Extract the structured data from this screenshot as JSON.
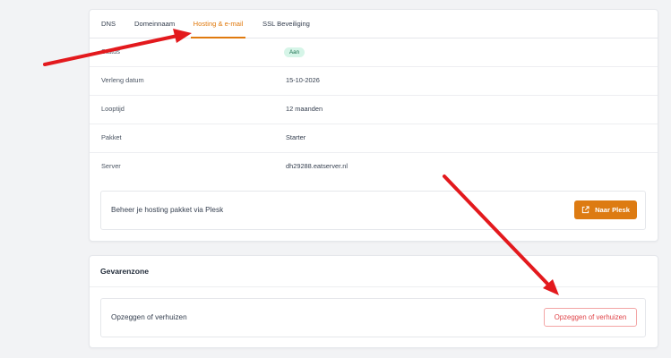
{
  "tabs": [
    {
      "label": "DNS"
    },
    {
      "label": "Domeinnaam"
    },
    {
      "label": "Hosting & e-mail",
      "active": true
    },
    {
      "label": "SSL Beveiliging"
    }
  ],
  "details": {
    "status_label": "Status",
    "status_value": "Aan",
    "rows": [
      {
        "label": "Verleng datum",
        "value": "15-10-2026"
      },
      {
        "label": "Looptijd",
        "value": "12 maanden"
      },
      {
        "label": "Pakket",
        "value": "Starter"
      },
      {
        "label": "Server",
        "value": "dh29288.eatserver.nl"
      }
    ]
  },
  "plesk": {
    "text": "Beheer je hosting pakket via Plesk",
    "button_label": "Naar Plesk",
    "button_icon": "external-link-icon"
  },
  "danger_zone": {
    "title": "Gevarenzone",
    "text": "Opzeggen of verhuizen",
    "button_label": "Opzeggen of verhuizen"
  },
  "colors": {
    "accent": "#dd7b12",
    "active_tab": "#e07a0e",
    "danger": "#e0454a",
    "badge_bg": "#d6f5e8",
    "arrow": "#e3191d"
  }
}
